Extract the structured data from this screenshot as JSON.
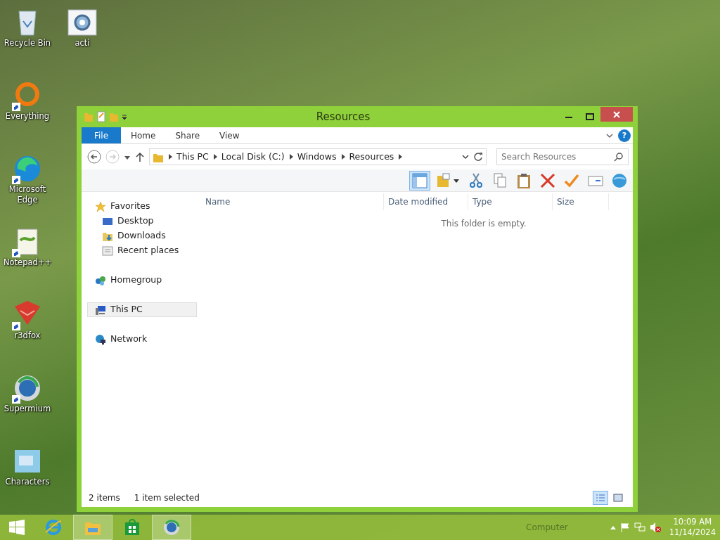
{
  "desktop_columns": [
    [
      {
        "label": "Recycle Bin",
        "kind": "recycle",
        "shortcut": false
      },
      {
        "label": "Everything",
        "kind": "ring",
        "shortcut": true
      },
      {
        "label": "Microsoft Edge",
        "kind": "edge",
        "shortcut": true
      },
      {
        "label": "Notepad++",
        "kind": "notepad",
        "shortcut": true
      },
      {
        "label": "r3dfox",
        "kind": "cube",
        "shortcut": true
      },
      {
        "label": "Supermium",
        "kind": "orb",
        "shortcut": true
      },
      {
        "label": "Characters",
        "kind": "picture",
        "shortcut": false
      }
    ],
    [
      {
        "label": "acti",
        "kind": "gear",
        "shortcut": false
      }
    ]
  ],
  "window": {
    "title": "Resources",
    "help_label": "?",
    "ribbon_tabs": [
      {
        "label": "File",
        "selected": true
      },
      {
        "label": "Home",
        "selected": false
      },
      {
        "label": "Share",
        "selected": false
      },
      {
        "label": "View",
        "selected": false
      }
    ],
    "breadcrumb": [
      "This PC",
      "Local Disk (C:)",
      "Windows",
      "Resources"
    ],
    "search": {
      "placeholder": "Search Resources"
    },
    "toolbar": [
      {
        "kind": "pane",
        "on": true
      },
      {
        "kind": "folder-dropdown",
        "on": false
      },
      {
        "kind": "cut",
        "on": false
      },
      {
        "kind": "copy",
        "on": false
      },
      {
        "kind": "paste",
        "on": false
      },
      {
        "kind": "delete",
        "on": false
      },
      {
        "kind": "check",
        "on": false
      },
      {
        "kind": "rename",
        "on": false
      },
      {
        "kind": "globe",
        "on": false
      }
    ],
    "nav_groups": [
      {
        "label": "Favorites",
        "kind": "star",
        "selected": false,
        "children": [
          {
            "label": "Desktop",
            "kind": "desktop",
            "selected": false
          },
          {
            "label": "Downloads",
            "kind": "download",
            "selected": false
          },
          {
            "label": "Recent places",
            "kind": "recent",
            "selected": false
          }
        ]
      },
      {
        "label": "Homegroup",
        "kind": "homegroup",
        "selected": false
      },
      {
        "label": "This PC",
        "kind": "pc",
        "selected": true
      },
      {
        "label": "Network",
        "kind": "network",
        "selected": false
      }
    ],
    "columns": [
      "Name",
      "Date modified",
      "Type",
      "Size"
    ],
    "empty_message": "This folder is empty.",
    "status": {
      "item_count": "2 items",
      "selection": "1 item selected"
    }
  },
  "taskbar": {
    "apps": [
      {
        "kind": "ie",
        "active": false
      },
      {
        "kind": "explorer",
        "active": true
      },
      {
        "kind": "store",
        "active": false
      },
      {
        "kind": "orb",
        "active": true
      }
    ],
    "ghost_text": "Computer",
    "time": "10:09 AM",
    "date": "11/14/2024"
  }
}
